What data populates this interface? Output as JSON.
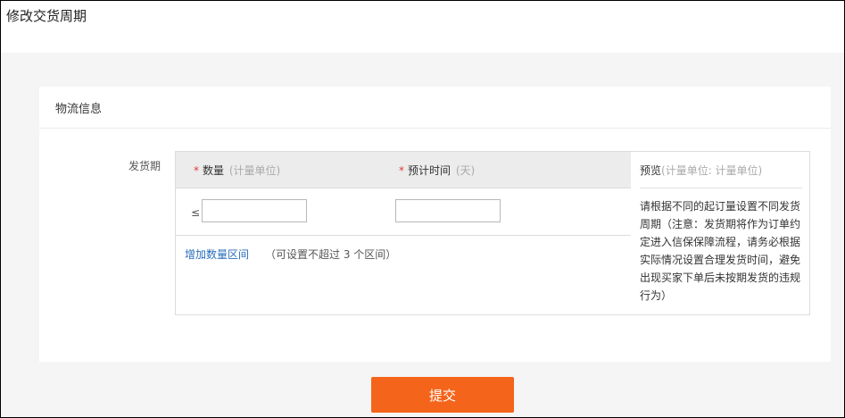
{
  "page": {
    "title": "修改交货周期"
  },
  "section": {
    "title": "物流信息"
  },
  "form": {
    "field_label": "发货期",
    "required_mark": "*",
    "columns": {
      "quantity": {
        "label": "数量",
        "hint": "(计量单位)"
      },
      "time": {
        "label": "预计时间",
        "hint": "(天)"
      }
    },
    "row": {
      "operator": "≤",
      "quantity_value": "",
      "time_value": ""
    },
    "add_range": {
      "link": "增加数量区间",
      "hint": "（可设置不超过 3 个区间）"
    }
  },
  "preview": {
    "title": "预览",
    "unit_hint": "(计量单位: 计量单位)",
    "text": "请根据不同的起订量设置不同发货周期（注意：发货期将作为订单约定进入信保保障流程，请务必根据实际情况设置合理发货时间，避免出现买家下单后未按期发货的违规行为）"
  },
  "actions": {
    "submit": "提交"
  },
  "colors": {
    "accent": "#f4641b",
    "link": "#2a6ebb",
    "required": "#e4393c"
  }
}
